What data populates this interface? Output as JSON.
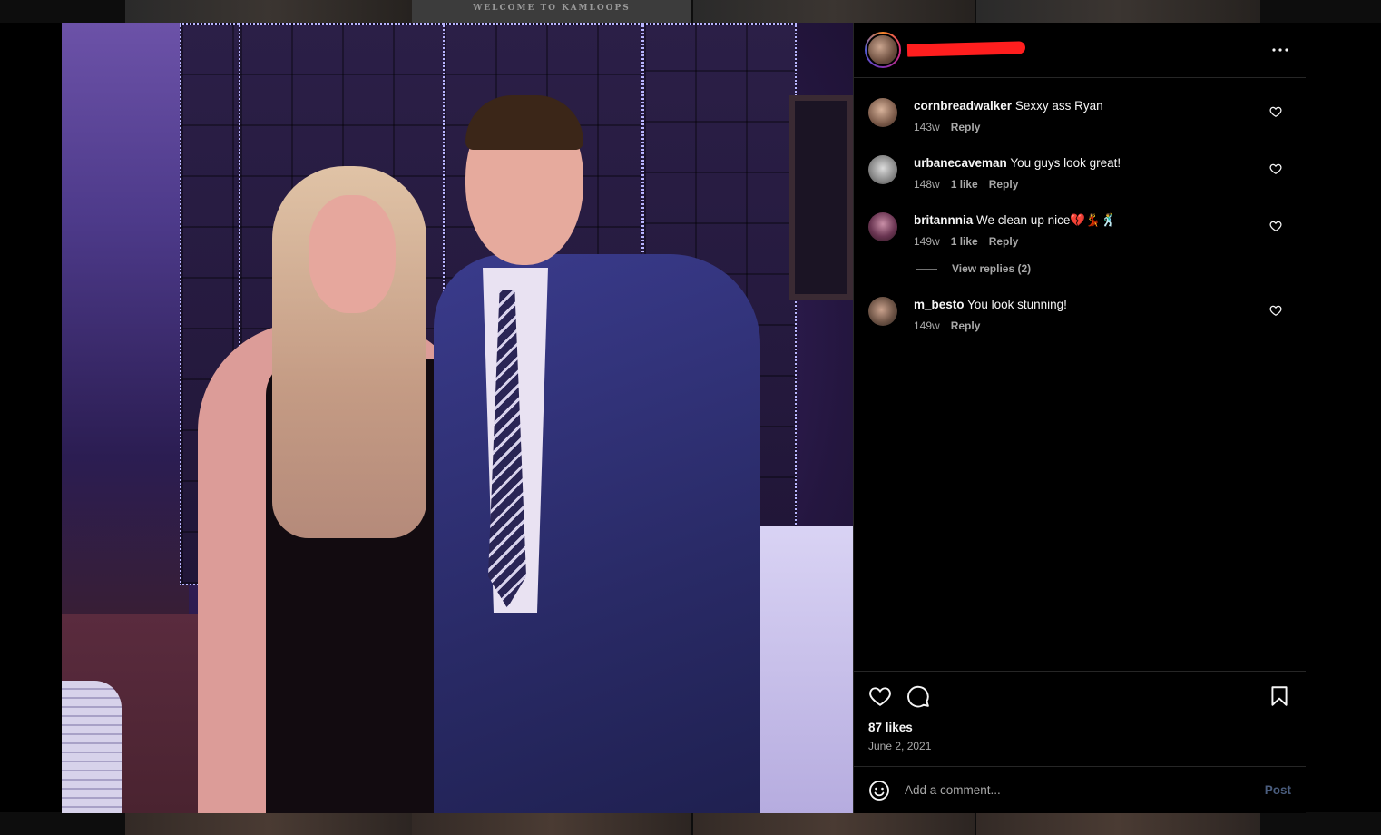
{
  "background": {
    "sign_text": "WELCOME TO KAMLOOPS"
  },
  "post": {
    "more_icon": "more-horizontal-icon",
    "likes": "87 likes",
    "date": "June 2, 2021"
  },
  "comments": [
    {
      "user": "cornbreadwalker",
      "text": "Sexxy ass Ryan",
      "age": "143w",
      "likes": "",
      "reply": "Reply"
    },
    {
      "user": "urbanecaveman",
      "text": "You guys look great!",
      "age": "148w",
      "likes": "1 like",
      "reply": "Reply"
    },
    {
      "user": "britannnia",
      "text": "We clean up nice💔💃🕺",
      "age": "149w",
      "likes": "1 like",
      "reply": "Reply"
    },
    {
      "user": "m_besto",
      "text": "You look stunning!",
      "age": "149w",
      "likes": "",
      "reply": "Reply"
    }
  ],
  "view_replies": "View replies (2)",
  "actions": {
    "like_icon": "heart-icon",
    "comment_icon": "comment-icon",
    "save_icon": "bookmark-icon"
  },
  "comment_box": {
    "placeholder": "Add a comment...",
    "post_label": "Post",
    "emoji_icon": "emoji-icon"
  },
  "colors": {
    "background": "#000000",
    "text": "#f5f5f5",
    "muted": "#a8a8a8",
    "divider": "#262626",
    "post_button_disabled": "#4a5d7e",
    "redaction": "#ff1e1e"
  }
}
